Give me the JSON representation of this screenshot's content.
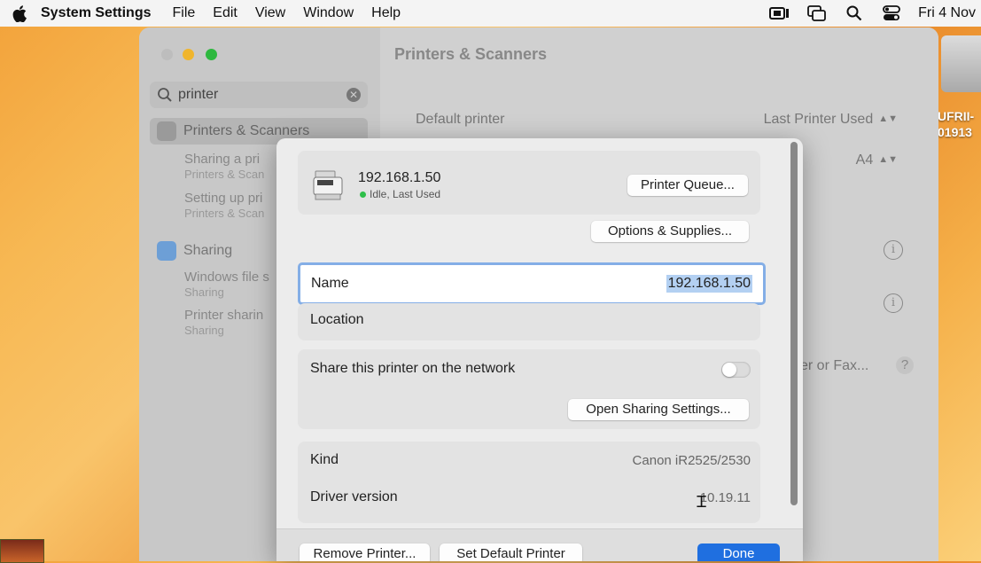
{
  "menubar": {
    "app": "System Settings",
    "menus": [
      "File",
      "Edit",
      "View",
      "Window",
      "Help"
    ],
    "clock": "Fri 4 Nov"
  },
  "desktop": {
    "disk_label": "UFRII-\n01913"
  },
  "sidebar": {
    "search_value": "printer",
    "items": [
      {
        "label": "Printers & Scanners"
      },
      {
        "label": "Sharing"
      }
    ],
    "subs": [
      {
        "title": "Sharing a pri",
        "sub": "Printers & Scan"
      },
      {
        "title": "Setting up pri",
        "sub": "Printers & Scan"
      },
      {
        "title": "Windows file s",
        "sub": "Sharing"
      },
      {
        "title": "Printer sharin",
        "sub": "Sharing"
      }
    ]
  },
  "main": {
    "title": "Printers & Scanners",
    "default_printer_label": "Default printer",
    "default_printer_value": "Last Printer Used",
    "paper_value": "A4",
    "add_label": "er or Fax...",
    "help": "?"
  },
  "dialog": {
    "printer_name": "192.168.1.50",
    "status": "Idle, Last Used",
    "printer_queue_btn": "Printer Queue...",
    "options_btn": "Options & Supplies...",
    "name_label": "Name",
    "name_value": "192.168.1.50",
    "location_label": "Location",
    "share_label": "Share this printer on the network",
    "share_enabled": false,
    "open_sharing_btn": "Open Sharing Settings...",
    "kind_label": "Kind",
    "kind_value": "Canon iR2525/2530",
    "driver_label": "Driver version",
    "driver_value": "10.19.11",
    "remove_btn": "Remove Printer...",
    "set_default_btn": "Set Default Printer",
    "done_btn": "Done"
  },
  "colors": {
    "accent": "#1f6fe0",
    "status_green": "#2fbf4a",
    "focus_ring": "#84aee6"
  }
}
